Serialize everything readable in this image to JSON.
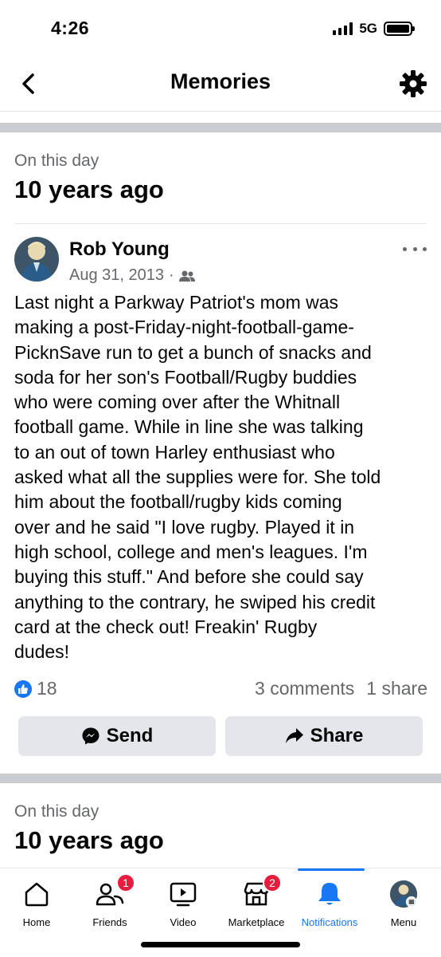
{
  "status_bar": {
    "time": "4:26",
    "network": "5G"
  },
  "header": {
    "title": "Memories"
  },
  "memory_sections": [
    {
      "on_this_day": "On this day",
      "years_ago": "10 years ago"
    },
    {
      "on_this_day": "On this day",
      "years_ago": "10 years ago"
    }
  ],
  "post": {
    "author": "Rob Young",
    "date": "Aug 31, 2013",
    "audience_separator": "·",
    "audience_icon": "friends-icon",
    "text": "Last night a Parkway Patriot's mom was\nmaking a post-Friday-night-football-game-\nPicknSave run to get a bunch of snacks and\nsoda for her son's Football/Rugby buddies\nwho were coming over after the Whitnall\nfootball game.  While in line she was talking\nto an out of town Harley enthusiast who\nasked what all the supplies were for.  She told\nhim about the football/rugby kids coming\nover and he said \"I love rugby.  Played it in\nhigh school, college and men's leagues.  I'm\nbuying this stuff.\"  And before she could say\nanything to the contrary, he swiped his credit\ncard at the check out!  Freakin'  Rugby\ndudes!",
    "reaction_count": "18",
    "comments": "3 comments",
    "shares": "1 share",
    "send_label": "Send",
    "share_label": "Share"
  },
  "bottom_nav": {
    "items": [
      {
        "label": "Home",
        "icon": "home-icon"
      },
      {
        "label": "Friends",
        "icon": "friends-icon",
        "badge": "1"
      },
      {
        "label": "Video",
        "icon": "video-icon"
      },
      {
        "label": "Marketplace",
        "icon": "marketplace-icon",
        "badge": "2"
      },
      {
        "label": "Notifications",
        "icon": "bell-icon",
        "active": true
      },
      {
        "label": "Menu",
        "icon": "profile-avatar"
      }
    ]
  },
  "colors": {
    "accent": "#1877f2",
    "badge": "#e41e3f",
    "secondary_text": "#65676b",
    "button_bg": "#e4e6eb"
  }
}
